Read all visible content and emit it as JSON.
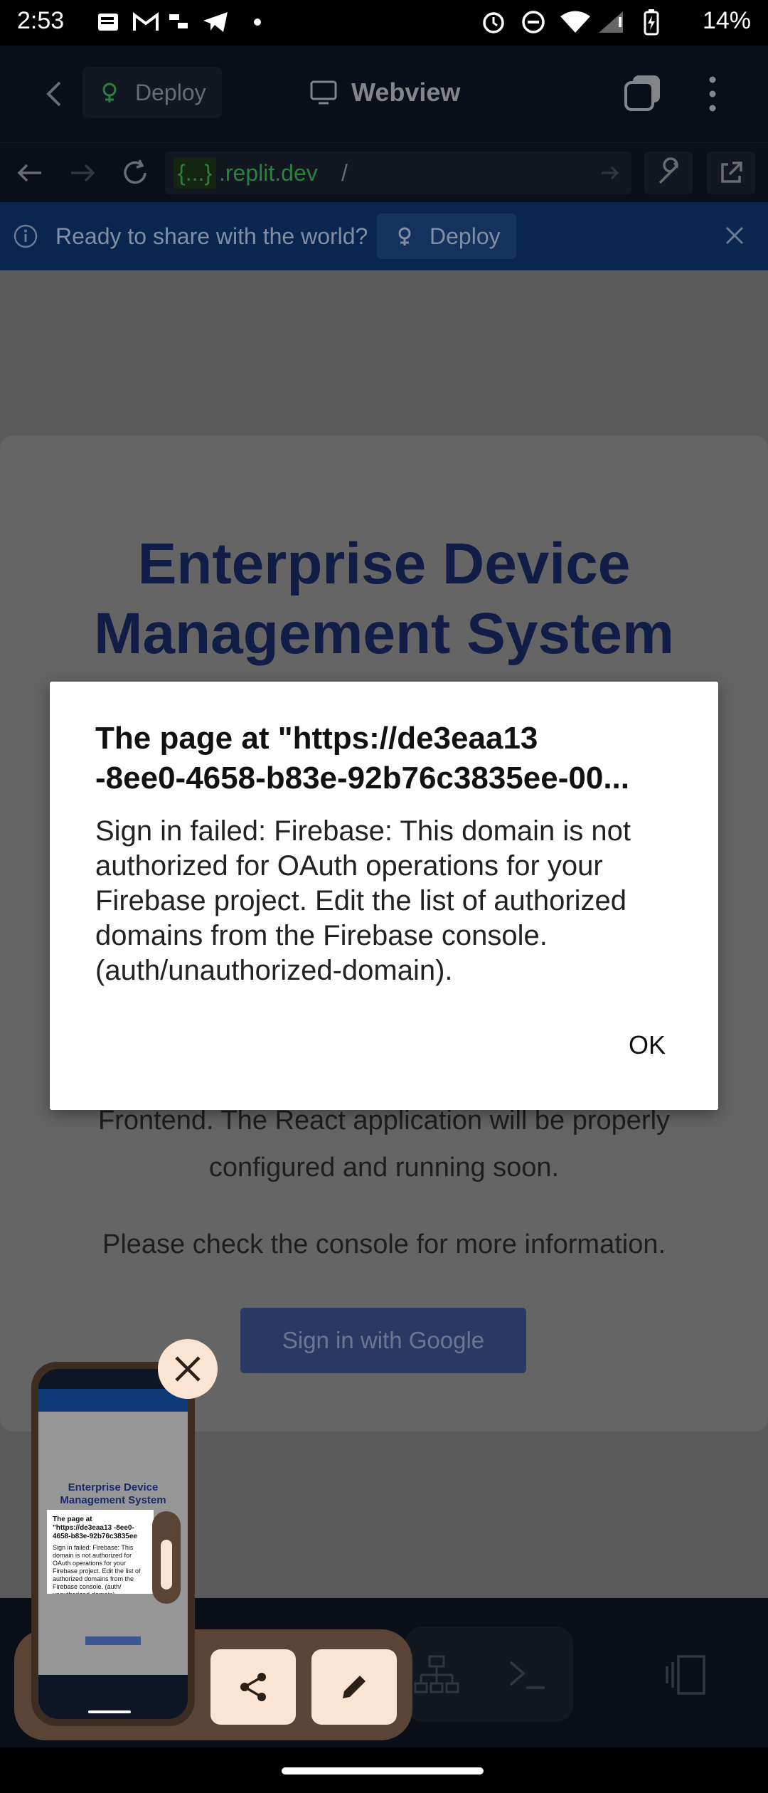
{
  "status_bar": {
    "time": "2:53",
    "battery": "14%"
  },
  "top_bar": {
    "deploy_label": "Deploy",
    "webview_label": "Webview"
  },
  "url_bar": {
    "badge": "{...}",
    "host": ".replit.dev",
    "path": "/"
  },
  "banner": {
    "message": "Ready to share with the world?",
    "deploy_label": "Deploy"
  },
  "page": {
    "title": "Enterprise Device Management System",
    "paragraph_1_line_1": "Frontend. The React application will be properly",
    "paragraph_1_line_2": "configured and running soon.",
    "paragraph_2": "Please check the console for more information.",
    "google_button": "Sign in with Google"
  },
  "dialog": {
    "title": "The page at \"https://de3eaa13\n-8ee0-4658-b83e-92b76c3835ee-00...",
    "message": "Sign in failed: Firebase: This domain is not authorized for OAuth operations for your Firebase project. Edit the list of authorized domains from the Firebase console. (auth/unauthorized-domain).",
    "ok_label": "OK"
  },
  "thumbnail": {
    "title": "Enterprise Device Management System",
    "dialog_title": "The page at \"https://de3eaa13 -8ee0-4658-b83e-92b76c3835ee",
    "dialog_message": "Sign in failed: Firebase: This domain is not authorized for OAuth operations for your Firebase project. Edit the list of authorized domains from the Firebase console. (auth/ unauthorized-domain)."
  },
  "colors": {
    "replit_bg": "#0e1525",
    "banner_bg": "#0e3a7a",
    "title_blue": "#1a2b6b",
    "google_button": "#3d5696",
    "overlay_peach": "#fce4d2"
  },
  "icons": [
    "back-icon",
    "deploy-icon",
    "webview-icon",
    "tabs-icon",
    "more-icon",
    "nav-back-icon",
    "nav-forward-icon",
    "reload-icon",
    "wrench-icon",
    "open-external-icon",
    "info-icon",
    "close-icon",
    "share-icon",
    "edit-icon",
    "network-icon",
    "terminal-icon",
    "panel-icon"
  ]
}
